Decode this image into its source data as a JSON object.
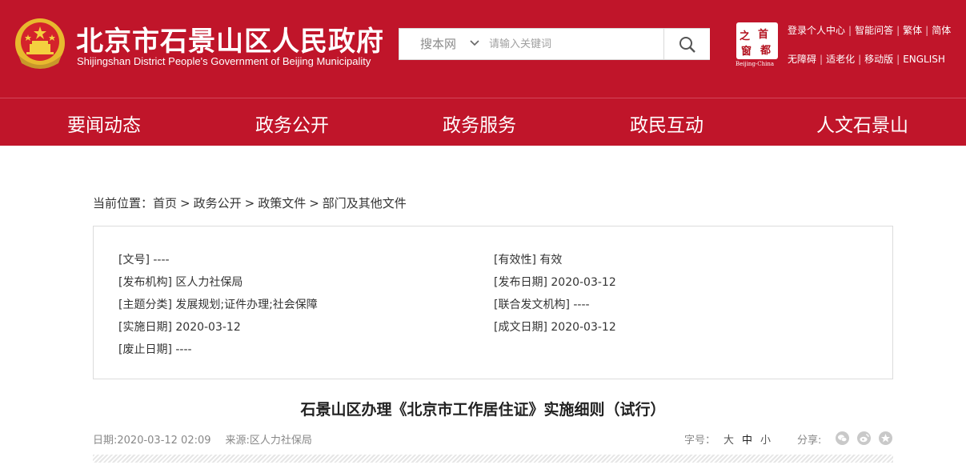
{
  "header": {
    "title": "北京市石景山区人民政府",
    "subtitle": "Shijingshan District People's Government of Beijing Municipality",
    "search": {
      "scope": "搜本网",
      "placeholder": "请输入关键词"
    },
    "capital_logo": {
      "chars": [
        "之",
        "首",
        "窗",
        "都"
      ],
      "caption": "Beijing-China"
    },
    "links_row1": [
      "登录个人中心",
      "智能问答",
      "繁体",
      "简体"
    ],
    "links_row2": [
      "无障碍",
      "适老化",
      "移动版",
      "ENGLISH"
    ]
  },
  "nav": {
    "items": [
      "要闻动态",
      "政务公开",
      "政务服务",
      "政民互动",
      "人文石景山"
    ]
  },
  "breadcrumb": {
    "label": "当前位置：",
    "items": [
      "首页",
      "政务公开",
      "政策文件",
      "部门及其他文件"
    ],
    "separator": ">"
  },
  "meta": {
    "doc_no": "[文号] ----",
    "validity": "[有效性] 有效",
    "issuer": "[发布机构] 区人力社保局",
    "publish_date": "[发布日期] 2020-03-12",
    "topic": "[主题分类] 发展规划;证件办理;社会保障",
    "joint_issuer": "[联合发文机构] ----",
    "effective_date": "[实施日期] 2020-03-12",
    "written_date": "[成文日期] 2020-03-12",
    "abolish_date": "[废止日期] ----"
  },
  "article": {
    "title": "石景山区办理《北京市工作居住证》实施细则（试行）",
    "date": "日期:2020-03-12 02:09",
    "source": "来源:区人力社保局",
    "fontsize_label": "字号：",
    "fontsize_options": [
      "大",
      "中",
      "小"
    ],
    "share_label": "分享:"
  },
  "colors": {
    "brand_red": "#c0152a",
    "text": "#333333",
    "muted": "#888888"
  }
}
